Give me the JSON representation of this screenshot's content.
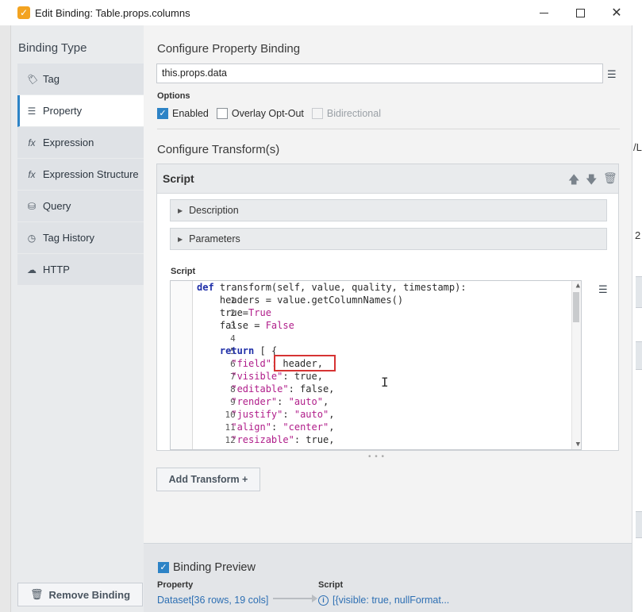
{
  "window": {
    "title": "Edit Binding: Table.props.columns",
    "app_icon_glyph": "✓"
  },
  "sidebar": {
    "title": "Binding Type",
    "items": [
      {
        "label": "Tag",
        "icon": "tag-icon",
        "glyph": "🏷",
        "active": false
      },
      {
        "label": "Property",
        "icon": "property-icon",
        "glyph": "☰",
        "active": true
      },
      {
        "label": "Expression",
        "icon": "fx-icon",
        "glyph": "fx",
        "active": false
      },
      {
        "label": "Expression Structure",
        "icon": "fx-icon",
        "glyph": "fx",
        "active": false
      },
      {
        "label": "Query",
        "icon": "database-icon",
        "glyph": "⛁",
        "active": false
      },
      {
        "label": "Tag History",
        "icon": "clock-icon",
        "glyph": "◷",
        "active": false
      },
      {
        "label": "HTTP",
        "icon": "cloud-icon",
        "glyph": "☁",
        "active": false
      }
    ],
    "remove_button": "Remove Binding"
  },
  "config": {
    "heading": "Configure Property Binding",
    "property_path": "this.props.data",
    "options_label": "Options",
    "options": {
      "enabled": "Enabled",
      "overlay": "Overlay Opt-Out",
      "bidirectional": "Bidirectional"
    }
  },
  "transforms": {
    "heading": "Configure Transform(s)",
    "card_title": "Script",
    "description_label": "Description",
    "parameters_label": "Parameters",
    "script_label": "Script",
    "add_button": "Add Transform +"
  },
  "code_lines": [
    "def transform(self, value, quality, timestamp):",
    "    headers = value.getColumnNames()",
    "    true=True",
    "    false = False",
    "",
    "    return [ {",
    "      \"field\": header,",
    "      \"visible\": true,",
    "      \"editable\": false,",
    "      \"render\": \"auto\",",
    "      \"justify\": \"auto\",",
    "      \"align\": \"center\",",
    "      \"resizable\": true,"
  ],
  "preview": {
    "title": "Binding Preview",
    "property_label": "Property",
    "property_value": "Dataset[36 rows, 19 cols]",
    "script_label": "Script",
    "script_value": "[{visible: true, nullFormat..."
  },
  "right_edge": {
    "text_a": "/L",
    "text_b": "2"
  }
}
